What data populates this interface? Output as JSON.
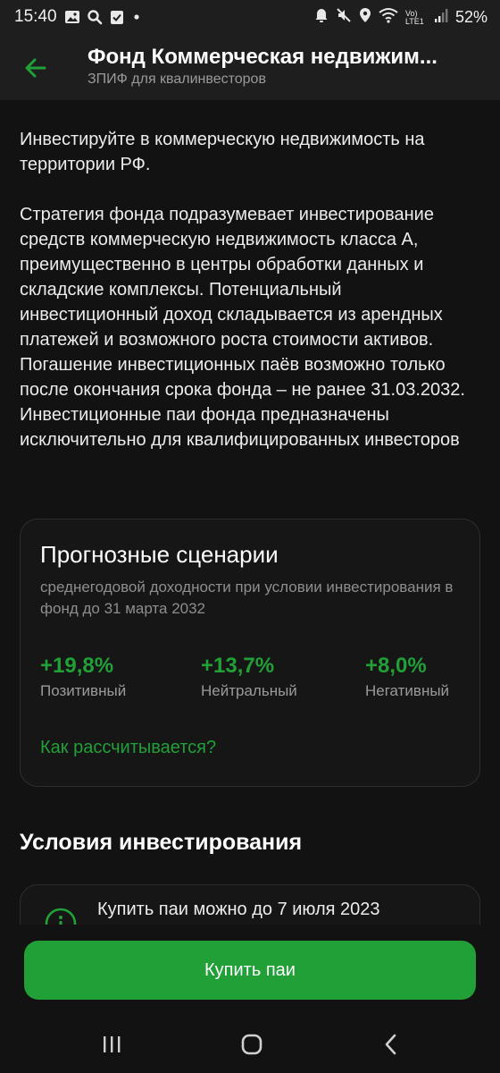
{
  "status_bar": {
    "time": "15:40",
    "battery": "52%",
    "network_label": "Vo) LTE1",
    "icons_left": [
      "image-icon",
      "search-icon",
      "check-icon",
      "dot-icon"
    ],
    "icons_right": [
      "alarm-icon",
      "mute-icon",
      "location-icon",
      "wifi-icon",
      "signal-icon"
    ]
  },
  "header": {
    "title": "Фонд Коммерческая недвижим...",
    "subtitle": "ЗПИФ для квалинвесторов",
    "back_icon": "arrow-left-icon"
  },
  "main": {
    "intro": "Инвестируйте в коммерческую недвижимость на территории РФ.",
    "strategy": "Стратегия фонда подразумевает инвестирование средств коммерческую недвижимость класса А, преимущественно в центры обработки данных и складские комплексы. Потенциальный инвестиционный доход складывается из арендных платежей и возможного роста стоимости активов. Погашение инвестиционных паёв возможно только после окончания срока фонда – не ранее 31.03.2032. Инвестиционные паи фонда предназначены исключительно для квалифицированных инвесторов"
  },
  "forecast": {
    "title": "Прогнозные сценарии",
    "subtitle": "среднегодовой доходности при условии инвестирования в фонд до 31 марта 2032",
    "scenarios": [
      {
        "value": "+19,8%",
        "label": "Позитивный"
      },
      {
        "value": "+13,7%",
        "label": "Нейтральный"
      },
      {
        "value": "+8,0%",
        "label": "Негативный"
      }
    ],
    "link": "Как рассчитывается?"
  },
  "conditions": {
    "title": "Условия инвестирования",
    "items": [
      {
        "icon": "info-icon",
        "text": "Купить паи можно до 7 июля 2023"
      }
    ]
  },
  "actions": {
    "buy_label": "Купить паи"
  },
  "colors": {
    "accent": "#21a038",
    "background": "#121212",
    "surface": "#1e1e1e"
  }
}
